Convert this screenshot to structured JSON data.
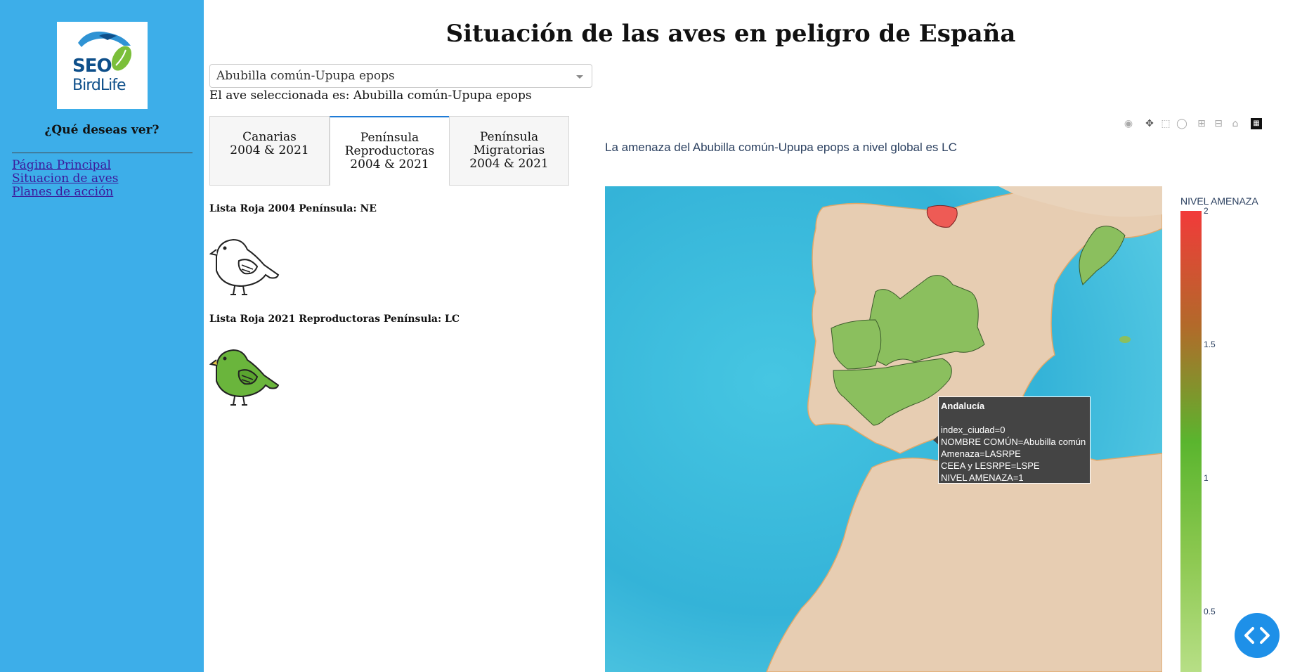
{
  "sidebar": {
    "logo": {
      "seo": "SEO",
      "birdlife": "BirdLife"
    },
    "question": "¿Qué deseas ver?",
    "links": [
      "Página Principal",
      "Situacion de aves",
      "Planes de acción"
    ]
  },
  "header": {
    "title": "Situación de las aves en peligro de España"
  },
  "selector": {
    "value": "Abubilla común-Upupa epops",
    "selected_text": "El ave seleccionada es: Abubilla común-Upupa epops"
  },
  "tabs": [
    {
      "label": "Canarias 2004 & 2021"
    },
    {
      "label": "Península Reproductoras 2004 & 2021"
    },
    {
      "label": "Península Migratorias 2004 & 2021"
    }
  ],
  "active_tab": 1,
  "red_list": {
    "label_2004": "Lista Roja 2004 Península: NE",
    "label_2021": "Lista Roja 2021 Reproductoras Península: LC"
  },
  "map": {
    "global_text": "La amenaza del Abubilla común-Upupa epops a nivel global es LC",
    "toolbar_icons": [
      "camera-icon",
      "pan-icon",
      "box-select-icon",
      "lasso-icon",
      "zoom-in-icon",
      "zoom-out-icon",
      "reset-home-icon",
      "plotly-logo-icon"
    ],
    "colorbar": {
      "title": "NIVEL AMENAZA",
      "ticks": [
        "2",
        "1.5",
        "1",
        "0.5"
      ]
    },
    "tooltip": {
      "title": "Andalucía",
      "lines": [
        "index_ciudad=0",
        "NOMBRE COMÚN=Abubilla común",
        "Amenaza=LASRPE",
        "CEEA y LESRPE=LSPE",
        "NIVEL AMENAZA=1"
      ]
    },
    "colors": {
      "sea": "#3fbfdc",
      "land": "#e7cdb2",
      "green_region": "#8bbf5e",
      "red_region": "#ee5b55"
    }
  }
}
